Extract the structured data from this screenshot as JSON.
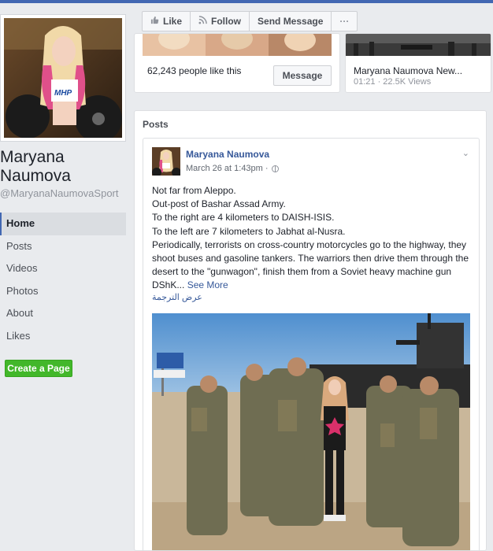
{
  "sidebar": {
    "page_name": "Maryana Naumova",
    "handle": "@MaryanaNaumovaSport",
    "nav": [
      {
        "label": "Home",
        "active": true
      },
      {
        "label": "Posts"
      },
      {
        "label": "Videos"
      },
      {
        "label": "Photos"
      },
      {
        "label": "About"
      },
      {
        "label": "Likes"
      }
    ],
    "create_page_label": "Create a Page"
  },
  "actions": {
    "like_label": "Like",
    "like_icon": "thumbs-up-icon",
    "follow_label": "Follow",
    "follow_icon": "rss-icon",
    "send_message_label": "Send Message",
    "more_label": "···"
  },
  "likes_card": {
    "text": "62,243 people like this",
    "message_label": "Message"
  },
  "video_card": {
    "title": "Maryana Naumova New...",
    "meta": "01:21 · 22.5K Views"
  },
  "posts": {
    "heading": "Posts",
    "post": {
      "author": "Maryana Naumova",
      "date": "March 26 at 1:43pm ·",
      "lines": [
        "Not far from Aleppo.",
        "Out-post of Bashar Assad Army.",
        "To the right are 4 kilometers to DAISH-ISIS.",
        "To the left are 7 kilometers to Jabhat al-Nusra.",
        "Periodically, terrorists on cross-country motorcycles go to the highway, they shoot buses and gasoline tankers. The warriors then drive them through the desert to the \"gunwagon\", finish them from a Soviet heavy machine gun DShK..."
      ],
      "see_more": "See More",
      "translate": "عرض الترجمة"
    }
  },
  "colors": {
    "brand": "#4267b2",
    "link": "#365899",
    "create_btn": "#42b72a"
  }
}
